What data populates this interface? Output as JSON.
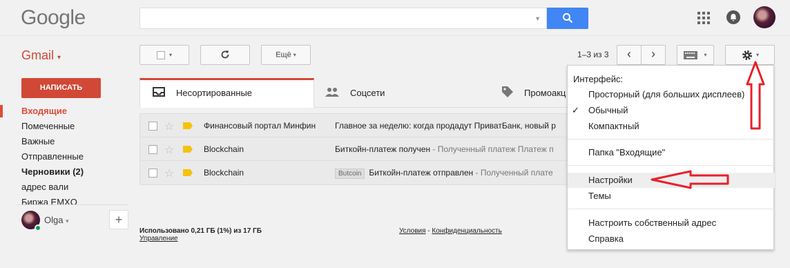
{
  "header": {
    "logo": "Google",
    "search_placeholder": ""
  },
  "app": {
    "label": "Gmail",
    "label_caret": "▾",
    "compose": "НАПИСАТЬ"
  },
  "toolbar": {
    "select_caret": "▾",
    "more": "Ещё",
    "more_caret": "▾",
    "pager": "1–3 из 3",
    "prev": "‹",
    "next": "›"
  },
  "sidebar": {
    "items": [
      {
        "label": "Входящие"
      },
      {
        "label": "Помеченные"
      },
      {
        "label": "Важные"
      },
      {
        "label": "Отправленные"
      },
      {
        "label": "Черновики (2)"
      },
      {
        "label": "адрес вали"
      },
      {
        "label": "Биржа EMXO"
      }
    ],
    "user": "Olga",
    "user_caret": "▾",
    "plus": "+"
  },
  "tabs": [
    {
      "label": "Несортированные"
    },
    {
      "label": "Соцсети"
    },
    {
      "label": "Промоакц"
    }
  ],
  "emails": [
    {
      "sender": "Финансовый портал Минфин",
      "label": "",
      "subject": "Главное за неделю: когда продадут ПриватБанк, новый р",
      "snippet": ""
    },
    {
      "sender": "Blockchain",
      "label": "",
      "subject": "Биткойн-платеж получен",
      "snippet": " - Полученный платеж Платеж п"
    },
    {
      "sender": "Blockchain",
      "label": "Butcoin",
      "subject": "Биткойн-платеж отправлен",
      "snippet": " - Полученный плате"
    }
  ],
  "footer": {
    "usage": "Использовано 0,21 ГБ (1%) из 17 ГБ",
    "manage": "Управление",
    "terms": "Условия",
    "sep": " - ",
    "privacy": "Конфиденциальность"
  },
  "settings_menu": {
    "heading": "Интерфейс:",
    "check": "✓",
    "items": [
      {
        "label": "Просторный (для больших дисплеев)"
      },
      {
        "label": "Обычный"
      },
      {
        "label": "Компактный"
      },
      {
        "label": "Папка \"Входящие\""
      },
      {
        "label": "Настройки"
      },
      {
        "label": "Темы"
      },
      {
        "label": "Настроить собственный адрес"
      },
      {
        "label": "Справка"
      }
    ]
  },
  "colors": {
    "accent": "#d14836",
    "search_button": "#4285f4",
    "annotation_red": "#e8202a"
  },
  "icons": [
    "search-icon",
    "apps-grid-icon",
    "notifications-icon",
    "refresh-icon",
    "keyboard-icon",
    "gear-icon",
    "inbox-icon",
    "people-icon",
    "tag-icon",
    "star-icon",
    "importance-icon"
  ]
}
